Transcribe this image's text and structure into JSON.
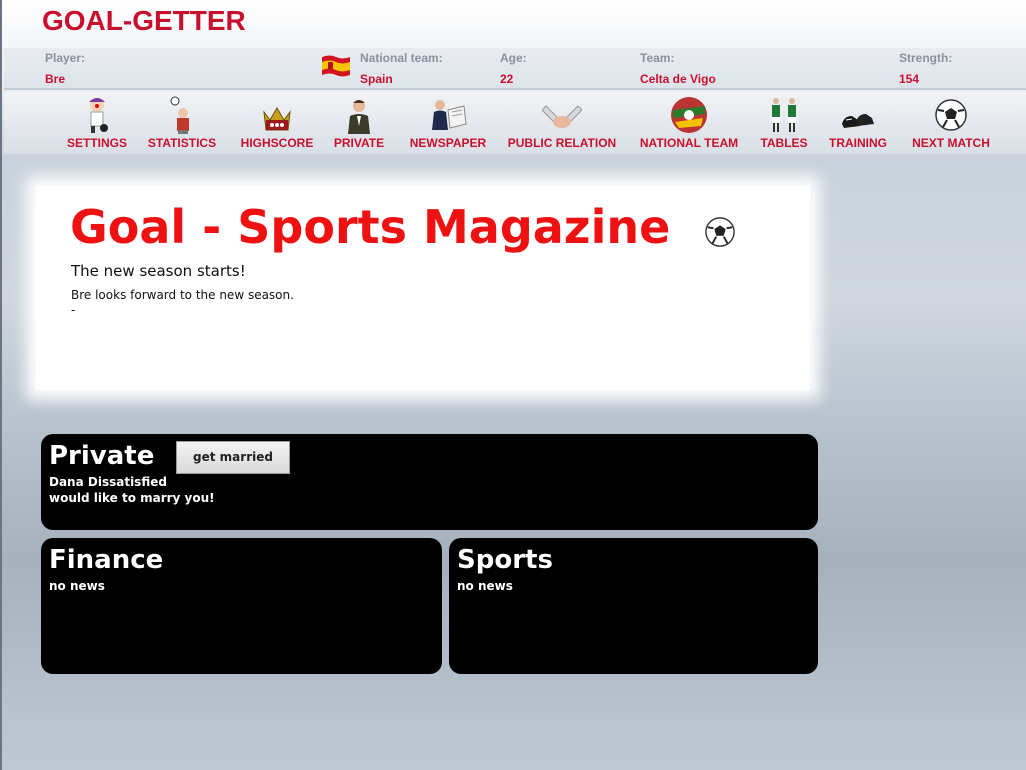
{
  "app": {
    "title": "GOAL-GETTER"
  },
  "info": {
    "player_label": "Player:",
    "player_value": "Bre",
    "national_label": "National team:",
    "national_value": "Spain",
    "age_label": "Age:",
    "age_value": "22",
    "team_label": "Team:",
    "team_value": "Celta de Vigo",
    "strength_label": "Strength:",
    "strength_value": "154"
  },
  "nav": {
    "settings": "SETTINGS",
    "statistics": "STATISTICS",
    "highscore": "HIGHSCORE",
    "private": "PRIVATE",
    "newspaper": "NEWSPAPER",
    "public_relation": "PUBLIC RELATION",
    "national_team": "NATIONAL TEAM",
    "tables": "TABLES",
    "training": "TRAINING",
    "next_match": "NEXT MATCH"
  },
  "magazine": {
    "title": "Goal - Sports Magazine",
    "headline": "The new season starts!",
    "line1": "Bre looks forward to the new season.",
    "line2": "-"
  },
  "private": {
    "title": "Private",
    "button": "get married",
    "line1": "Dana Dissatisfied",
    "line2": "would like to marry you!"
  },
  "finance": {
    "title": "Finance",
    "text": "no news"
  },
  "sports": {
    "title": "Sports",
    "text": "no news"
  },
  "colors": {
    "accent": "#c8102e",
    "magazine_title": "#ee1111",
    "label": "#8a929c"
  },
  "icons": {
    "settings": "clown-icon",
    "statistics": "juggler-icon",
    "highscore": "crown-icon",
    "private": "man-in-suit-icon",
    "newspaper": "newspaper-reader-icon",
    "public_relation": "handshake-icon",
    "national_team": "flags-ball-icon",
    "tables": "players-icon",
    "training": "boots-icon",
    "next_match": "soccer-ball-icon"
  }
}
